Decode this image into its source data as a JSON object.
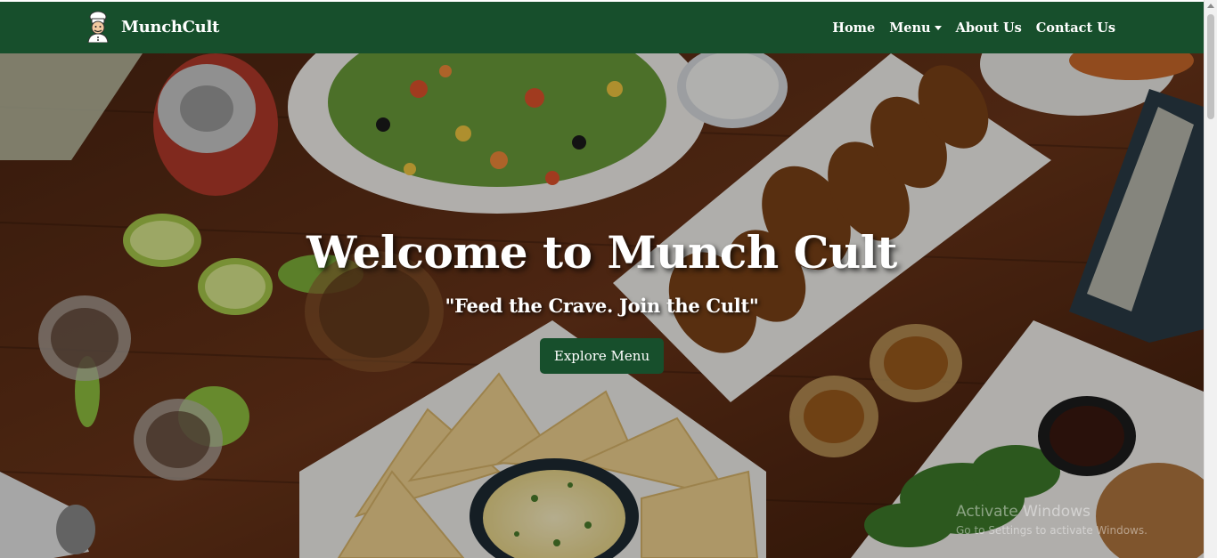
{
  "navbar": {
    "brand_name": "MunchCult",
    "logo_icon": "chef-mascot-icon",
    "background_color": "#174f2c",
    "links": [
      {
        "label": "Home"
      },
      {
        "label": "Menu",
        "has_dropdown": true
      },
      {
        "label": "About Us"
      },
      {
        "label": "Contact Us"
      }
    ]
  },
  "hero": {
    "title": "Welcome to Munch Cult",
    "tagline": "\"Feed the Crave. Join the Cult\"",
    "button_label": "Explore Menu",
    "button_color": "#174f2c"
  },
  "watermark": {
    "line1": "Activate Windows",
    "line2": "Go to Settings to activate Windows."
  }
}
